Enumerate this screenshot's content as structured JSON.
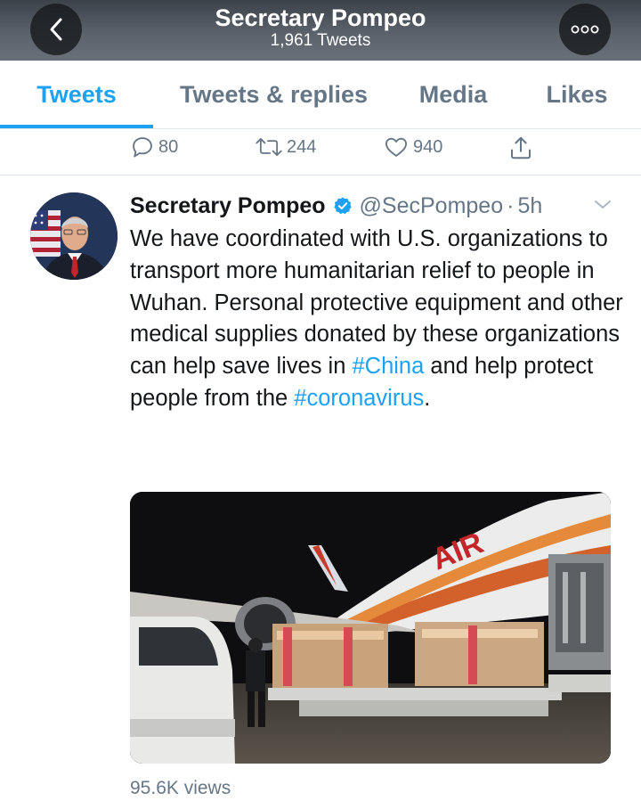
{
  "header": {
    "title": "Secretary Pompeo",
    "subtitle": "1,961 Tweets",
    "back_icon": "chevron-left-icon",
    "more_icon": "more-dots-icon"
  },
  "tabs": [
    {
      "label": "Tweets",
      "active": true
    },
    {
      "label": "Tweets & replies",
      "active": false
    },
    {
      "label": "Media",
      "active": false
    },
    {
      "label": "Likes",
      "active": false
    }
  ],
  "previous_tweet_actions": {
    "replies": "80",
    "retweets": "244",
    "likes": "940"
  },
  "tweet": {
    "author": "Secretary Pompeo",
    "handle": "@SecPompeo",
    "separator": "·",
    "time": "5h",
    "text_part1": "We have coordinated with U.S. organizations to transport more humanitarian relief to people in Wuhan. Personal protective equipment and other medical supplies donated by these organizations can help save lives in ",
    "hashtag1": "#China",
    "text_part2": " and help protect people from the ",
    "hashtag2": "#coronavirus",
    "text_part3": ".",
    "views": "95.6K views",
    "media_aircraft_lettering": "AIR"
  },
  "colors": {
    "accent": "#1da1f2",
    "secondary_text": "#657786",
    "primary_text": "#14171a",
    "header_bg": "#4a5058"
  }
}
